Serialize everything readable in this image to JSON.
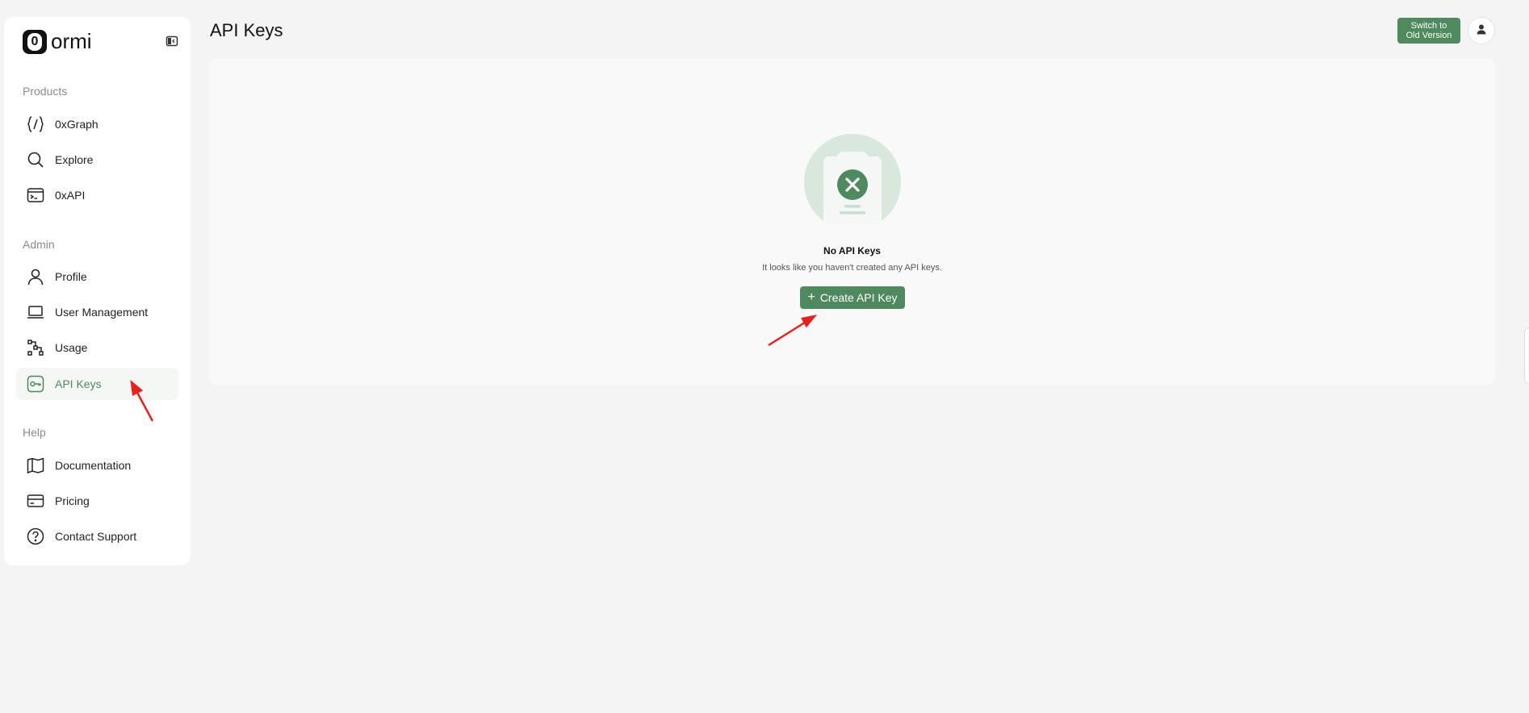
{
  "brand": {
    "logo_glyph": "0",
    "name": "ormi"
  },
  "sidebar": {
    "products_label": "Products",
    "admin_label": "Admin",
    "help_label": "Help",
    "products": [
      {
        "label": "0xGraph",
        "icon": "code-braces-icon"
      },
      {
        "label": "Explore",
        "icon": "search-icon"
      },
      {
        "label": "0xAPI",
        "icon": "terminal-icon"
      }
    ],
    "admin": [
      {
        "label": "Profile",
        "icon": "user-icon"
      },
      {
        "label": "User Management",
        "icon": "laptop-icon"
      },
      {
        "label": "Usage",
        "icon": "usage-icon"
      },
      {
        "label": "API Keys",
        "icon": "key-icon",
        "active": true
      }
    ],
    "help": [
      {
        "label": "Documentation",
        "icon": "book-icon"
      },
      {
        "label": "Pricing",
        "icon": "credit-card-icon"
      },
      {
        "label": "Contact Support",
        "icon": "help-circle-icon"
      }
    ]
  },
  "header": {
    "title": "API Keys",
    "switch_line1": "Switch to",
    "switch_line2": "Old Version"
  },
  "empty_state": {
    "title": "No API Keys",
    "description": "It looks like you haven't created any API keys.",
    "button_label": "Create API Key"
  },
  "colors": {
    "accent": "#4e8a5e",
    "annotation": "#e8201c",
    "background": "#f4f4f4"
  }
}
